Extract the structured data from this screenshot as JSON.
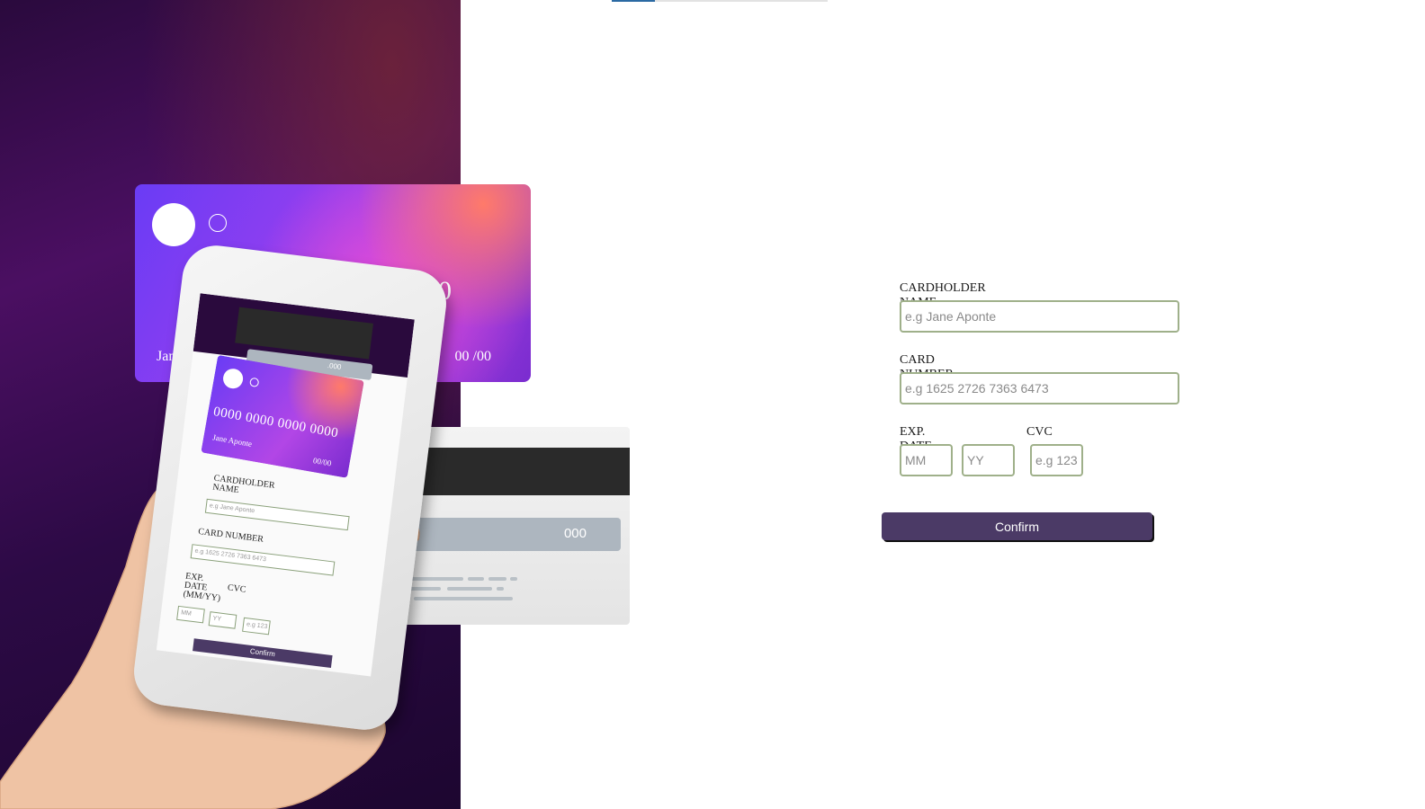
{
  "card_preview": {
    "number": "0000 0000 0000 0000",
    "number_visible": "00",
    "holder": "Jane A",
    "exp": "00 /00",
    "cvc": "000"
  },
  "phone_preview": {
    "card_number": "0000 0000 0000 0000",
    "card_holder": "Jane Aponte",
    "card_exp": "00/00",
    "back_cvc": ".000",
    "cardholder_label": "CARDHOLDER NAME",
    "cardholder_placeholder": "e.g Jane Aponte",
    "number_label": "CARD NUMBER",
    "number_placeholder": "e.g 1625 2726 7363 6473",
    "exp_label": "EXP. DATE (MM/YY)",
    "cvc_label": "CVC",
    "mm_placeholder": "MM",
    "yy_placeholder": "YY",
    "cvc_placeholder": "e.g 123",
    "confirm": "Confirm"
  },
  "form": {
    "cardholder_label": "CARDHOLDER NAME",
    "cardholder_placeholder": "e.g Jane Aponte",
    "cardholder_value": "",
    "number_label": "CARD NUMBER",
    "number_placeholder": "e.g 1625 2726 7363 6473",
    "number_value": "",
    "exp_label": "EXP. DATE (MM/YY)",
    "mm_placeholder": "MM",
    "yy_placeholder": "YY",
    "cvc_label": "CVC",
    "cvc_placeholder": "e.g 123",
    "confirm_label": "Confirm"
  },
  "colors": {
    "accent": "#4b3a66",
    "field_border": "#9fb08a",
    "panel_dark": "#2a0a3d"
  }
}
